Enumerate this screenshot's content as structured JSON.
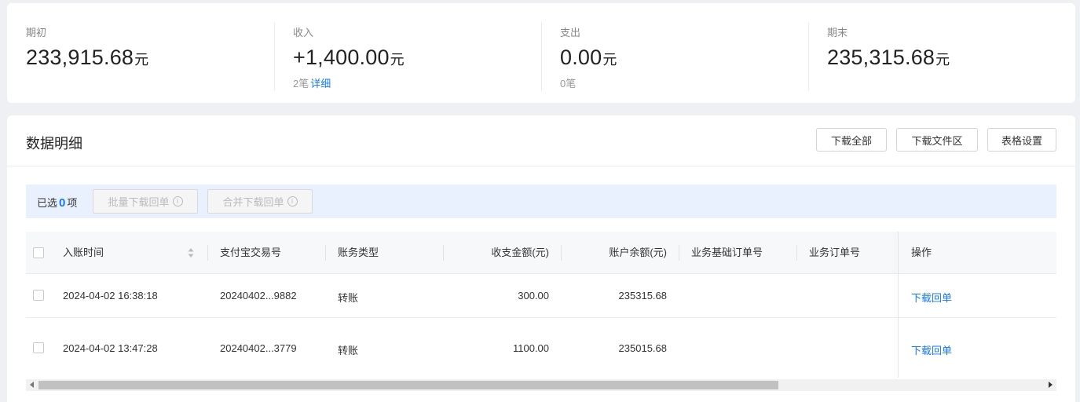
{
  "summary": {
    "opening": {
      "label": "期初",
      "value": "233,915.68",
      "unit": "元"
    },
    "income": {
      "label": "收入",
      "value": "+1,400.00",
      "unit": "元",
      "count": "2笔",
      "detail_link": "详细"
    },
    "expense": {
      "label": "支出",
      "value": "0.00",
      "unit": "元",
      "count": "0笔"
    },
    "closing": {
      "label": "期末",
      "value": "235,315.68",
      "unit": "元"
    }
  },
  "detail": {
    "title": "数据明细",
    "buttons": {
      "download_all": "下载全部",
      "download_files": "下载文件区",
      "table_settings": "表格设置"
    }
  },
  "selection": {
    "prefix": "已选",
    "count": "0",
    "suffix": "项",
    "batch_download": "批量下载回单",
    "merge_download": "合并下载回单"
  },
  "table": {
    "columns": {
      "time": "入账时间",
      "trade_no": "支付宝交易号",
      "type": "账务类型",
      "amount": "收支金额(元)",
      "balance": "账户余额(元)",
      "base_order": "业务基础订单号",
      "order": "业务订单号",
      "action": "操作"
    },
    "rows": [
      {
        "time": "2024-04-02 16:38:18",
        "trade_no": "20240402...9882",
        "type": "转账",
        "amount": "300.00",
        "balance": "235315.68",
        "base_order": "",
        "order": "",
        "action": "下载回单"
      },
      {
        "time": "2024-04-02 13:47:28",
        "trade_no": "20240402...3779",
        "type": "转账",
        "amount": "1100.00",
        "balance": "235015.68",
        "base_order": "",
        "order": "",
        "action": "下载回单"
      }
    ]
  },
  "colors": {
    "accent": "#1677ff",
    "background": "#eef0f3",
    "selection_bar": "#e8f1fd"
  },
  "icons": [
    "info-icon",
    "sort-icon",
    "scroll-left-arrow-icon",
    "scroll-right-arrow-icon"
  ]
}
